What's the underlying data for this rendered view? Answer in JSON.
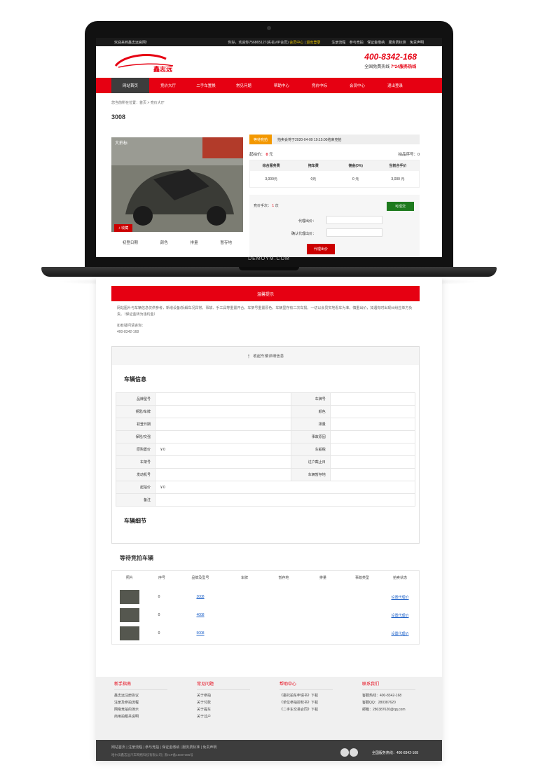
{
  "top": {
    "welcome": "欢迎来到鑫志远官网！",
    "user_prefix": "你好，欢迎你756865127(实名VIP会员)",
    "member_center": "会员中心",
    "logout": "退出登录",
    "links": [
      "注册流程",
      "参与竞拍",
      "保证金缴纳",
      "服务费标准",
      "免责声明"
    ]
  },
  "header": {
    "logo_text": "鑫志远",
    "hotline": "400-8342-168",
    "hotline_sub": "全国免费热线",
    "hotline_hours": "7*24服务热线"
  },
  "nav": [
    "网站首页",
    "竞价大厅",
    "二手车置换",
    "常见问题",
    "帮助中心",
    "竞价中标",
    "会员中心",
    "退出登录"
  ],
  "crumb": "您当前所在位置：首页 > 竞价大厅",
  "lot_title": "3008",
  "photo_label": "大拍标",
  "collect": "+ 收藏",
  "car_sub": [
    "初登日期",
    "颜色",
    "排量",
    "暂存地"
  ],
  "notice": {
    "tag": "等待竞拍",
    "text": "拍卖会将于2020-04-09 19:15:00结束竞拍"
  },
  "start_price": "起拍价：",
  "start_price_val": "0",
  "start_price_unit": "元",
  "lot_no": "拍品序号：0",
  "fees": {
    "headers": [
      "综合服务费",
      "拖车费",
      "佣金(0%)",
      "当前合手价"
    ],
    "values": [
      "3,000元",
      "0元",
      "0 元",
      "3,000 元"
    ]
  },
  "bid": {
    "count_label": "竞价手次：",
    "count": "1",
    "count_unit": "次",
    "done_button": "可成交",
    "proxy_label": "代理出价：",
    "confirm_label": "确认代理出价：",
    "submit": "代理出价"
  },
  "brand": "DEMOYM.COM",
  "warning": {
    "title": "温馨提示",
    "text": "网站图片与车辆信息仅供参考，新增设备/拆解车况异常，事故、手工具等重置开合，车架号重置原色，车辆里存有二次车损，一切以会员实地看车为准，慎重出价，如遇有时出现纠纷应单方负责。（保证金转为违约金）",
    "contact_label": "如有疑问请咨询：",
    "contact": "400-8342-168"
  },
  "collapse": "收起车辆详细信息",
  "vehicle_info_title": "车辆信息",
  "vehicle_rows": [
    [
      "品牌型号",
      "",
      "车牌号",
      ""
    ],
    [
      "钥匙/车牌",
      "",
      "颜色",
      ""
    ],
    [
      "初登日期",
      "",
      "排量",
      ""
    ],
    [
      "保险/交强",
      "",
      "事故原因",
      ""
    ],
    [
      "原购置价",
      "￥0",
      "车船税",
      ""
    ],
    [
      "车架号",
      "",
      "过户截止日",
      ""
    ],
    [
      "发动机号",
      "",
      "车辆暂存地",
      ""
    ],
    [
      "起拍价",
      "￥0",
      "",
      ""
    ],
    [
      "备注",
      "",
      "",
      ""
    ]
  ],
  "vehicle_detail_title": "车辆细节",
  "waiting": {
    "title": "等待竞拍车辆",
    "headers": [
      "照片",
      "序号",
      "品牌及型号",
      "车牌",
      "暂存地",
      "排量",
      "事故类型",
      "拍卖状态"
    ],
    "rows": [
      {
        "no": "0",
        "model": "3008",
        "status": "设置代理价"
      },
      {
        "no": "0",
        "model": "4008",
        "status": "设置代理价"
      },
      {
        "no": "0",
        "model": "5008",
        "status": "设置代理价"
      }
    ]
  },
  "footer": {
    "cols": [
      {
        "title": "新手指南",
        "items": [
          "鑫志远注册协议",
          "注册及参拍流程",
          "网络竞拍的演示",
          "商用拍租共说明"
        ]
      },
      {
        "title": "常见问题",
        "items": [
          "关于参拍",
          "关于付款",
          "关于提车",
          "关于过户"
        ]
      },
      {
        "title": "帮助中心",
        "items": [
          "《委托拍车申请书》下载",
          "《单位参拍授权书》下载",
          "《二手车交易合同》下载"
        ]
      },
      {
        "title": "联系我们",
        "items": [
          "客服热线：400-8342-168",
          "客服QQ：280387620",
          "邮箱：280387620@qq.com"
        ]
      }
    ],
    "bar_links": "网站首页  |  注册流程  |  参与竞拍  |  保证金缴纳  |  服务费标准  |  免责声明",
    "copyright": "哈尔滨鑫志远汽车网络科技有限公司  |  黑ICP备15007385号",
    "tel": "全国服务热线：400-8342-168"
  },
  "colors": {
    "brand": "#e60012",
    "dark": "#3d3d3d"
  }
}
